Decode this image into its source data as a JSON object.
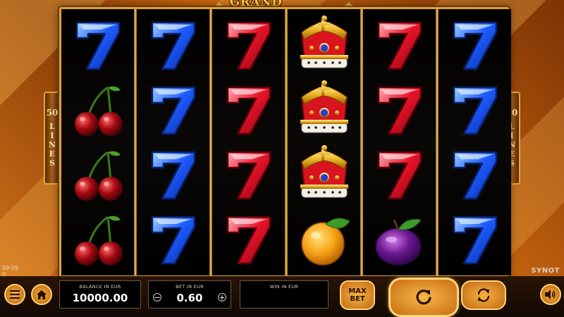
{
  "game": {
    "title": "GRAND MONEY",
    "provider": "SYNOT"
  },
  "paylines": {
    "count": "50",
    "label": "LINES"
  },
  "status": {
    "time": "09:09",
    "extra": "0"
  },
  "reels": [
    [
      "seven-blue",
      "cherry",
      "cherry",
      "cherry"
    ],
    [
      "seven-blue",
      "seven-blue",
      "seven-blue",
      "seven-blue"
    ],
    [
      "seven-red",
      "seven-red",
      "seven-red",
      "seven-red"
    ],
    [
      "crown",
      "crown",
      "crown",
      "orange"
    ],
    [
      "seven-red",
      "seven-red",
      "seven-red",
      "plum"
    ],
    [
      "seven-blue",
      "seven-blue",
      "seven-blue",
      "seven-blue"
    ]
  ],
  "controls": {
    "balance_label": "BALANCE IN EUR",
    "balance_value": "10000.00",
    "bet_label": "BET IN EUR",
    "bet_value": "0.60",
    "bet_minus": "−",
    "bet_plus": "+",
    "win_label": "WIN IN EUR",
    "win_value": "",
    "max_bet_line1": "MAX",
    "max_bet_line2": "BET"
  },
  "icons": {
    "menu": "menu-icon",
    "home": "home-icon",
    "spin": "spin-icon",
    "autoplay": "autoplay-icon",
    "sound": "sound-icon"
  },
  "colors": {
    "accent_gold": "#ffd24a",
    "button_orange": "#f6b040",
    "panel_bg": "#000000"
  }
}
